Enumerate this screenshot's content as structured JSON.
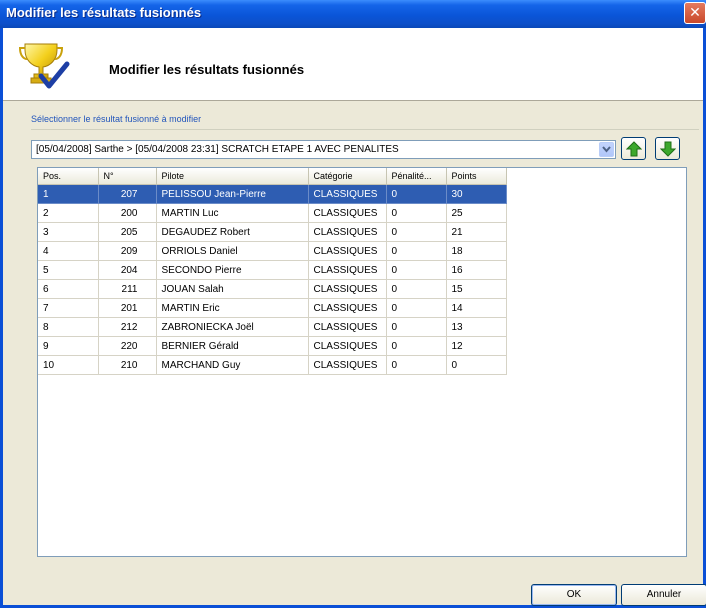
{
  "window": {
    "title": "Modifier les résultats fusionnés"
  },
  "header": {
    "title": "Modifier les résultats fusionnés",
    "icon": "trophy-check-icon"
  },
  "selector": {
    "label": "Sélectionner le résultat fusionné à modifier",
    "value": "[05/04/2008] Sarthe > [05/04/2008 23:31] SCRATCH ETAPE 1 AVEC PENALITES",
    "move_up_icon": "green-arrow-up-icon",
    "move_down_icon": "green-arrow-down-icon"
  },
  "table": {
    "columns": [
      "Pos.",
      "N°",
      "Pilote",
      "Catégorie",
      "Pénalité...",
      "Points"
    ],
    "rows": [
      [
        "1",
        "207",
        "PELISSOU Jean-Pierre",
        "CLASSIQUES",
        "0",
        "30"
      ],
      [
        "2",
        "200",
        "MARTIN Luc",
        "CLASSIQUES",
        "0",
        "25"
      ],
      [
        "3",
        "205",
        "DEGAUDEZ Robert",
        "CLASSIQUES",
        "0",
        "21"
      ],
      [
        "4",
        "209",
        "ORRIOLS Daniel",
        "CLASSIQUES",
        "0",
        "18"
      ],
      [
        "5",
        "204",
        "SECONDO Pierre",
        "CLASSIQUES",
        "0",
        "16"
      ],
      [
        "6",
        "211",
        "JOUAN Salah",
        "CLASSIQUES",
        "0",
        "15"
      ],
      [
        "7",
        "201",
        "MARTIN Eric",
        "CLASSIQUES",
        "0",
        "14"
      ],
      [
        "8",
        "212",
        "ZABRONIECKA Joël",
        "CLASSIQUES",
        "0",
        "13"
      ],
      [
        "9",
        "220",
        "BERNIER Gérald",
        "CLASSIQUES",
        "0",
        "12"
      ],
      [
        "10",
        "210",
        "MARCHAND Guy",
        "CLASSIQUES",
        "0",
        "0"
      ]
    ],
    "selected_row": 0
  },
  "buttons": {
    "ok": "OK",
    "cancel": "Annuler"
  },
  "colors": {
    "titlebar": "#0a55d8",
    "selection": "#2e5db2",
    "face": "#ece9d8"
  }
}
